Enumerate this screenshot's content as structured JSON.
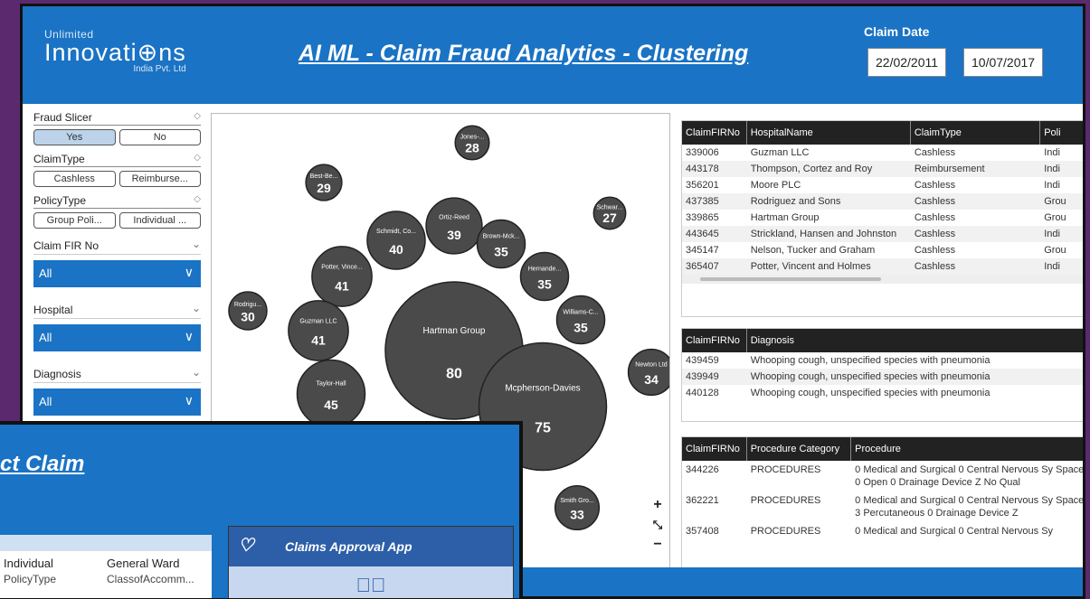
{
  "header": {
    "logo_line1": "Unlimited",
    "logo_line2": "Innovati⊕ns",
    "logo_line3": "India Pvt. Ltd",
    "title": "AI ML - Claim Fraud  Analytics - Clustering",
    "claim_date_label": "Claim Date",
    "date_from": "22/02/2011",
    "date_to": "10/07/2017"
  },
  "slicers": {
    "fraud": {
      "title": "Fraud Slicer",
      "options": [
        "Yes",
        "No"
      ],
      "selected": "Yes"
    },
    "claim_type": {
      "title": "ClaimType",
      "options": [
        "Cashless",
        "Reimburse..."
      ]
    },
    "policy_type": {
      "title": "PolicyType",
      "options": [
        "Group Poli...",
        "Individual ..."
      ]
    },
    "claim_fir": {
      "title": "Claim FIR No",
      "value": "All"
    },
    "hospital": {
      "title": "Hospital",
      "value": "All"
    },
    "diagnosis": {
      "title": "Diagnosis",
      "value": "All"
    }
  },
  "chart_data": {
    "type": "scatter",
    "subtype": "bubble",
    "bubbles": [
      {
        "name": "Jones-...",
        "value": 28
      },
      {
        "name": "Best-Be...",
        "value": 29
      },
      {
        "name": "Schmidt, Co...",
        "value": 40
      },
      {
        "name": "Ortiz-Reed",
        "value": 39
      },
      {
        "name": "Brown-Mck...",
        "value": 35
      },
      {
        "name": "Schwar...",
        "value": 27
      },
      {
        "name": "Potter, Vince...",
        "value": 41
      },
      {
        "name": "Hernande...",
        "value": 35
      },
      {
        "name": "Rodrigu...",
        "value": 30
      },
      {
        "name": "Guzman LLC",
        "value": 41
      },
      {
        "name": "Hartman Group",
        "value": 80
      },
      {
        "name": "Williams-C...",
        "value": 35
      },
      {
        "name": "Newton Ltd",
        "value": 34
      },
      {
        "name": "Taylor-Hall",
        "value": 45
      },
      {
        "name": "Mcpherson-Davies",
        "value": 75
      },
      {
        "name": "Smith Gro...",
        "value": 33
      }
    ],
    "bubble_color": "#4a4a4a"
  },
  "claims_table": {
    "headers": [
      "ClaimFIRNo",
      "HospitalName",
      "ClaimType",
      "Poli"
    ],
    "rows": [
      [
        "339006",
        "Guzman LLC",
        "Cashless",
        "Indi"
      ],
      [
        "443178",
        "Thompson, Cortez and Roy",
        "Reimbursement",
        "Indi"
      ],
      [
        "356201",
        "Moore PLC",
        "Cashless",
        "Indi"
      ],
      [
        "437385",
        "Rodriguez and Sons",
        "Cashless",
        "Grou"
      ],
      [
        "339865",
        "Hartman Group",
        "Cashless",
        "Grou"
      ],
      [
        "443645",
        "Strickland, Hansen and Johnston",
        "Cashless",
        "Indi"
      ],
      [
        "345147",
        "Nelson, Tucker and Graham",
        "Cashless",
        "Grou"
      ],
      [
        "365407",
        "Potter, Vincent and Holmes",
        "Cashless",
        "Indi"
      ]
    ]
  },
  "diagnosis_table": {
    "headers": [
      "ClaimFIRNo",
      "Diagnosis"
    ],
    "rows": [
      [
        "439459",
        "Whooping cough, unspecified species with pneumonia"
      ],
      [
        "439949",
        "Whooping cough, unspecified species with pneumonia"
      ],
      [
        "440128",
        "Whooping cough, unspecified species with pneumonia"
      ]
    ]
  },
  "procedure_table": {
    "headers": [
      "ClaimFIRNo",
      "Procedure Category",
      "Procedure"
    ],
    "rows": [
      [
        "344226",
        "PROCEDURES",
        "0 Medical and Surgical 0 Central Nervous Sy Space 0 Open 0 Drainage Device Z No Qual"
      ],
      [
        "362221",
        "PROCEDURES",
        "0 Medical and Surgical 0 Central Nervous Sy Space 3 Percutaneous 0 Drainage Device Z"
      ],
      [
        "357408",
        "PROCEDURES",
        "0 Medical and Surgical 0 Central Nervous Sy"
      ]
    ]
  },
  "zoom_controls": {
    "plus": "+",
    "fit": "⤡",
    "minus": "−"
  },
  "overlay": {
    "title": "ct Claim",
    "policy_value": "Individual",
    "policy_label": "PolicyType",
    "ward_value": "General Ward",
    "ward_label": "ClassofAccomm...",
    "app_title": "Claims Approval App",
    "app_icon": "heart-pulse-icon",
    "check_icon": "check-circle-icon"
  }
}
